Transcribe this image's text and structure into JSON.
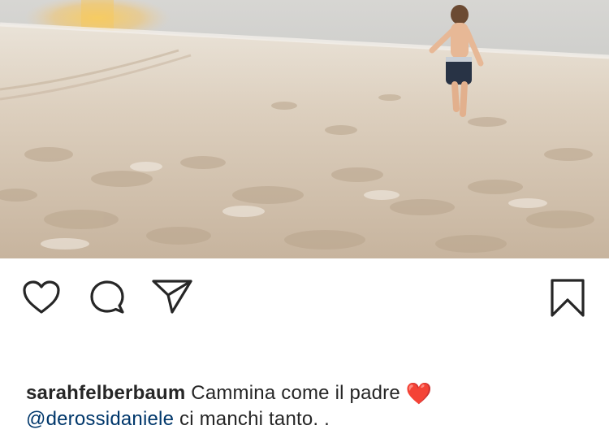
{
  "post": {
    "image_alt": "Child walking on a sandy beach at sunset",
    "icons": {
      "like": "heart-outline-icon",
      "comment": "comment-bubble-icon",
      "share": "paper-plane-icon",
      "save": "bookmark-icon"
    },
    "caption": {
      "username": "sarahfelberbaum",
      "text": "Cammina come il padre",
      "emoji": "❤️",
      "mention": "@derossidaniele",
      "continuation": "ci manchi tanto. ."
    }
  }
}
